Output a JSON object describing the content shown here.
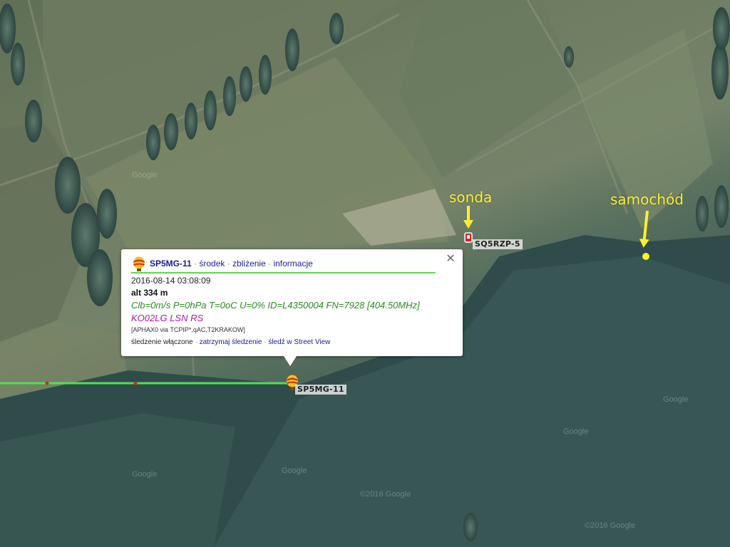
{
  "map": {
    "track_color": "#4be34b",
    "annotation_color": "#ffef2e",
    "watermarks": [
      "Google",
      "Google",
      "Google",
      "Google",
      "Google",
      "©2016 Google",
      "©2016 Google"
    ]
  },
  "markers": {
    "balloon_callsign": "SP5MG-11",
    "probe_callsign": "SQ5RZP-5"
  },
  "annotations": {
    "probe_label": "sonda",
    "car_label": "samochód"
  },
  "popup": {
    "icon": "balloon-icon",
    "callsign": "SP5MG-11",
    "links": {
      "center": "środek",
      "zoom": "zbliżenie",
      "info": "informacje"
    },
    "separator": " · ",
    "close_icon": "close-icon",
    "timestamp": "2016-08-14 03:08:09",
    "altitude": "alt 334 m",
    "telemetry": "Clb=0m/s P=0hPa T=0oC U=0% ID=L4350004 FN=7928 [404.50MHz]",
    "comment": "KO02LG LSN RS",
    "path": "[APHAX0 via TCPIP*,qAC,T2KRAKOW]",
    "tracking": {
      "status": "śledzenie włączone",
      "stop": "zatrzymaj śledzenie",
      "streetview": "śledź w Street View"
    }
  }
}
